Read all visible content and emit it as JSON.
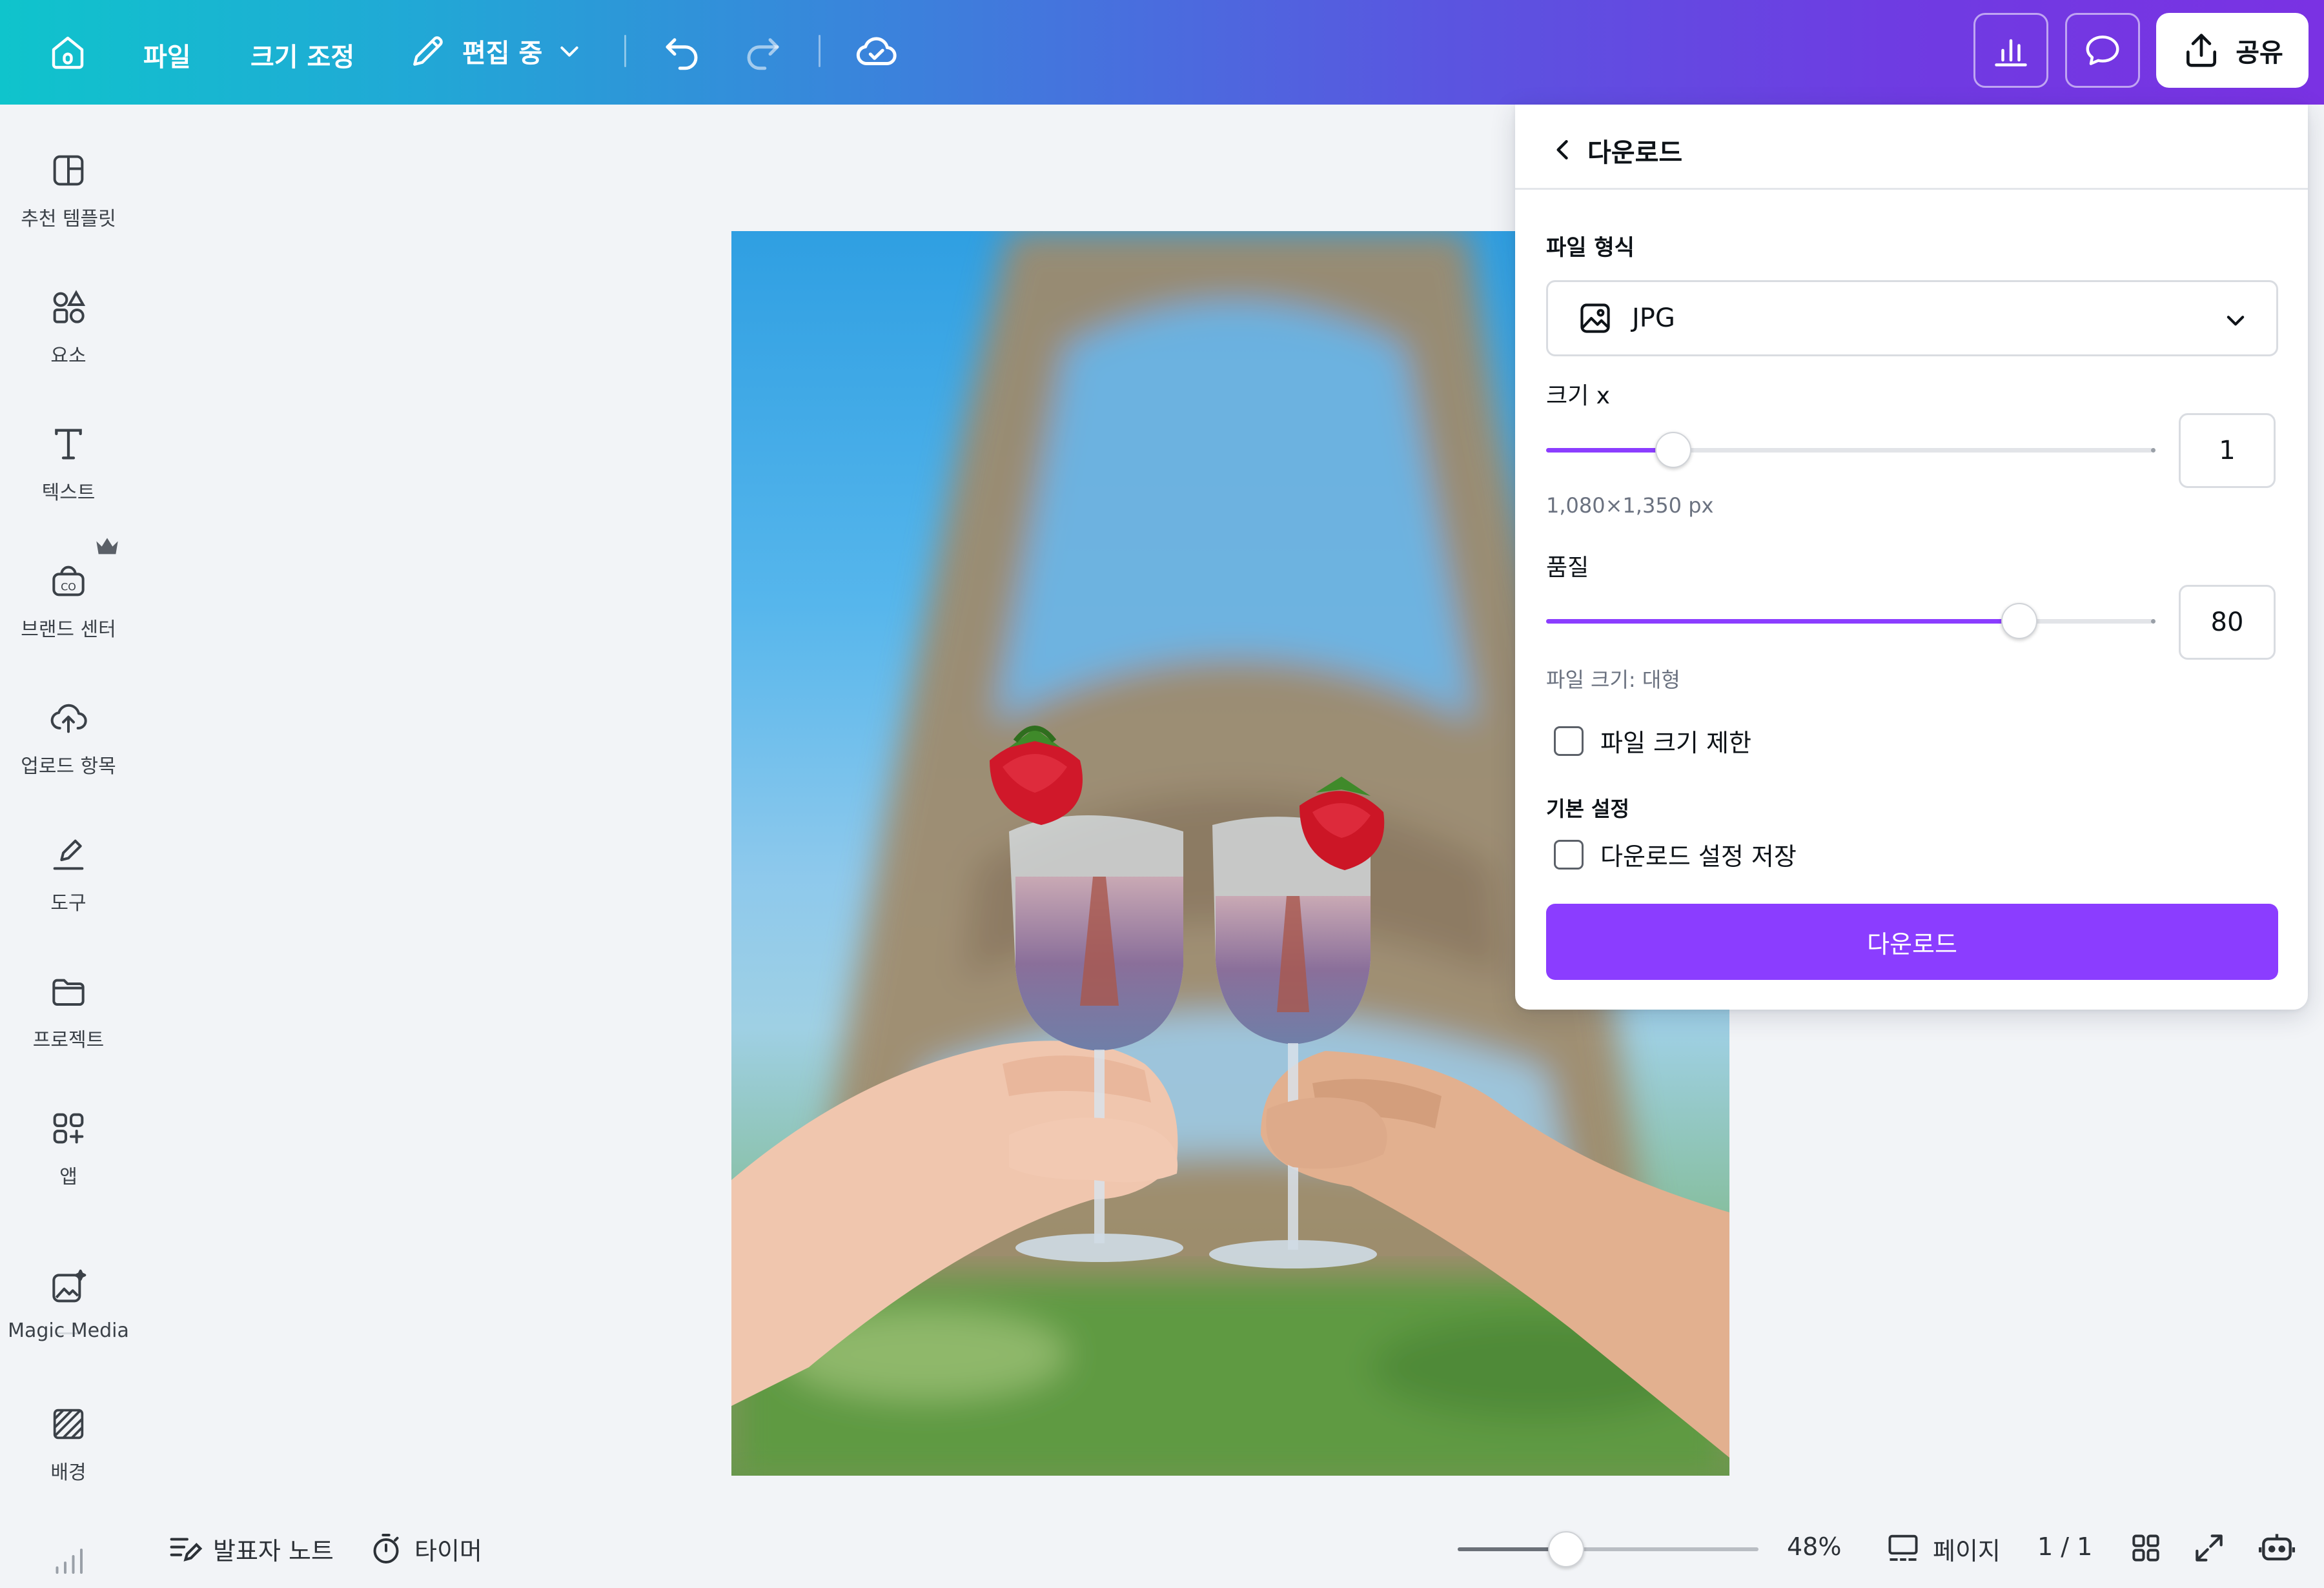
{
  "topbar": {
    "home_icon": "home-icon",
    "file_label": "파일",
    "resize_label": "크기 조정",
    "editing_label": "편집 중",
    "share_label": "공유",
    "gradient_start": "#0fc4cc",
    "gradient_end": "#7a32e3"
  },
  "sidebar": {
    "items": [
      {
        "label": "추천 템플릿",
        "icon": "template-icon"
      },
      {
        "label": "요소",
        "icon": "elements-icon"
      },
      {
        "label": "텍스트",
        "icon": "text-icon"
      },
      {
        "label": "브랜드 센터",
        "icon": "brand-icon"
      },
      {
        "label": "업로드 항목",
        "icon": "upload-icon"
      },
      {
        "label": "도구",
        "icon": "draw-icon"
      },
      {
        "label": "프로젝트",
        "icon": "folder-icon"
      },
      {
        "label": "앱",
        "icon": "apps-icon"
      },
      {
        "label": "Magic Media",
        "icon": "magic-media-icon"
      },
      {
        "label": "배경",
        "icon": "background-icon"
      }
    ]
  },
  "panel": {
    "title": "다운로드",
    "file_type_label": "파일 형식",
    "file_type_value": "JPG",
    "size_label": "크기 x",
    "size_value": "1",
    "size_fraction": 0.21,
    "dimensions": "1,080×1,350 px",
    "quality_label": "품질",
    "quality_value": "80",
    "quality_fraction": 0.78,
    "file_size_text": "파일 크기: 대형",
    "limit_checkbox_label": "파일 크기 제한",
    "defaults_label": "기본 설정",
    "save_checkbox_label": "다운로드 설정 저장",
    "download_button": "다운로드",
    "accent": "#8b3dff"
  },
  "bottombar": {
    "notes_label": "발표자 노트",
    "timer_label": "타이머",
    "zoom_percent": "48%",
    "zoom_fraction": 0.36,
    "pages_label": "페이지",
    "page_count": "1 / 1"
  }
}
